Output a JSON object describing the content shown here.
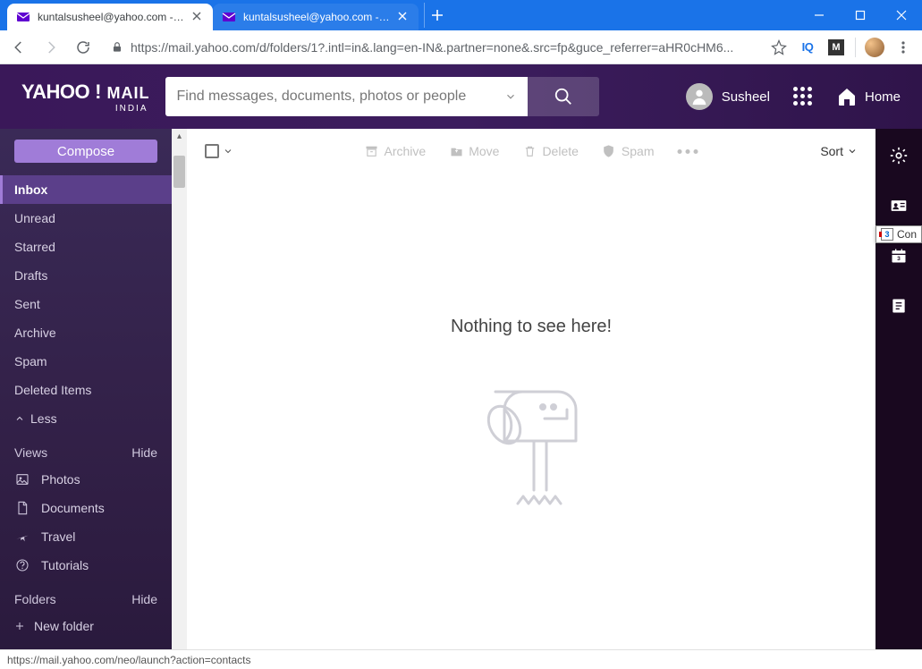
{
  "browser": {
    "tabs": [
      {
        "title": "kuntalsusheel@yahoo.com - Yahoo",
        "active": true
      },
      {
        "title": "kuntalsusheel@yahoo.com - Yahoo",
        "active": false
      }
    ],
    "url": "https://mail.yahoo.com/d/folders/1?.intl=in&.lang=en-IN&.partner=none&.src=fp&guce_referrer=aHR0cHM6...",
    "status": "https://mail.yahoo.com/neo/launch?action=contacts"
  },
  "header": {
    "logo_brand": "YAHOO",
    "logo_bang": "!",
    "logo_product": "MAIL",
    "logo_region": "INDIA",
    "search_placeholder": "Find messages, documents, photos or people",
    "user_name": "Susheel",
    "home_label": "Home"
  },
  "sidebar": {
    "compose_label": "Compose",
    "folders": [
      "Inbox",
      "Unread",
      "Starred",
      "Drafts",
      "Sent",
      "Archive",
      "Spam",
      "Deleted Items"
    ],
    "active_folder": "Inbox",
    "less_label": "Less",
    "views_header": "Views",
    "views_hide": "Hide",
    "views": [
      "Photos",
      "Documents",
      "Travel",
      "Tutorials"
    ],
    "folders_header": "Folders",
    "folders_hide": "Hide",
    "new_folder_label": "New folder"
  },
  "toolbar": {
    "archive": "Archive",
    "move": "Move",
    "delete": "Delete",
    "spam": "Spam",
    "sort": "Sort"
  },
  "content": {
    "empty_text": "Nothing to see here!"
  },
  "rail": {
    "tooltip": "Con"
  }
}
